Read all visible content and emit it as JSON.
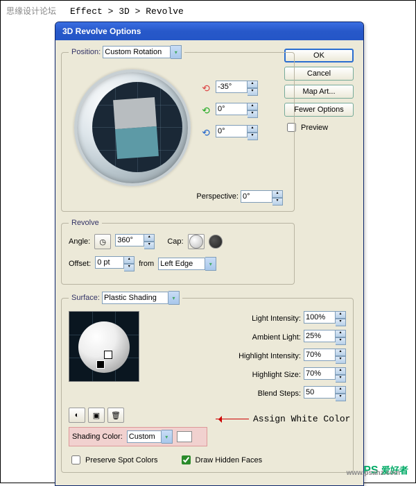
{
  "watermark_left": "思缘设计论坛",
  "watermark_right_1": "PS",
  "watermark_right_2": "爱好者",
  "watermark_url": "www.psahz.com",
  "breadcrumb": "Effect > 3D > Revolve",
  "dialog_title": "3D Revolve Options",
  "buttons": {
    "ok": "OK",
    "cancel": "Cancel",
    "map": "Map Art...",
    "fewer": "Fewer Options"
  },
  "preview_label": "Preview",
  "position": {
    "legend": "Position",
    "mode": "Custom Rotation",
    "x": "-35°",
    "y": "0°",
    "z": "0°",
    "perspective_label": "Perspective:",
    "perspective": "0°"
  },
  "revolve": {
    "legend": "Revolve",
    "angle_label": "Angle:",
    "angle": "360°",
    "cap_label": "Cap:",
    "offset_label": "Offset:",
    "offset": "0 pt",
    "from_label": "from",
    "from": "Left Edge"
  },
  "surface": {
    "legend": "Surface:",
    "mode": "Plastic Shading",
    "light_intensity_label": "Light Intensity:",
    "light_intensity": "100%",
    "ambient_light_label": "Ambient Light:",
    "ambient_light": "25%",
    "highlight_intensity_label": "Highlight Intensity:",
    "highlight_intensity": "70%",
    "highlight_size_label": "Highlight Size:",
    "highlight_size": "70%",
    "blend_steps_label": "Blend Steps:",
    "blend_steps": "50",
    "shading_color_label": "Shading Color:",
    "shading_color": "Custom",
    "preserve_label": "Preserve Spot Colors",
    "hidden_label": "Draw Hidden Faces"
  },
  "annotation": "Assign White Color"
}
